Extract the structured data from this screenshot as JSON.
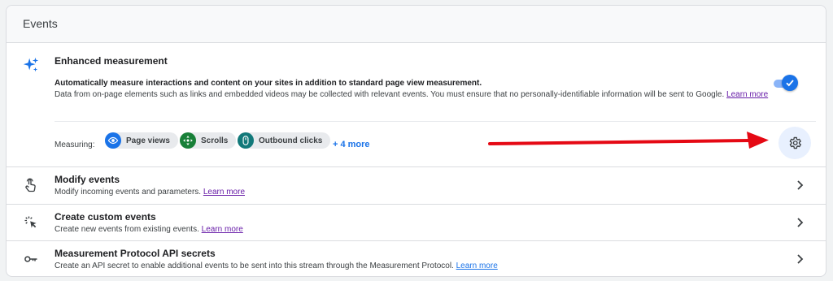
{
  "card": {
    "title": "Events"
  },
  "enhanced": {
    "title": "Enhanced measurement",
    "desc_strong": "Automatically measure interactions and content on your sites in addition to standard page view measurement.",
    "desc": "Data from on-page elements such as links and embedded videos may be collected with relevant events. You must ensure that no personally-identifiable information will be sent to Google.",
    "learn_more": "Learn more",
    "toggle_on": true,
    "measuring_label": "Measuring:",
    "chips": [
      {
        "label": "Page views",
        "icon": "eye-icon"
      },
      {
        "label": "Scrolls",
        "icon": "scroll-arrows-icon"
      },
      {
        "label": "Outbound clicks",
        "icon": "mouse-icon"
      }
    ],
    "more_label": "+ 4 more",
    "settings_icon": "gear-icon"
  },
  "rows": [
    {
      "title": "Modify events",
      "desc": "Modify incoming events and parameters.",
      "learn_more": "Learn more",
      "icon": "touch-hand-icon"
    },
    {
      "title": "Create custom events",
      "desc": "Create new events from existing events.",
      "learn_more": "Learn more",
      "icon": "click-cursor-icon"
    },
    {
      "title": "Measurement Protocol API secrets",
      "desc": "Create an API secret to enable additional events to be sent into this stream through the Measurement Protocol.",
      "learn_more": "Learn more",
      "icon": "key-icon"
    }
  ],
  "colors": {
    "accent": "#1a73e8",
    "annotation_arrow": "#e50914"
  }
}
